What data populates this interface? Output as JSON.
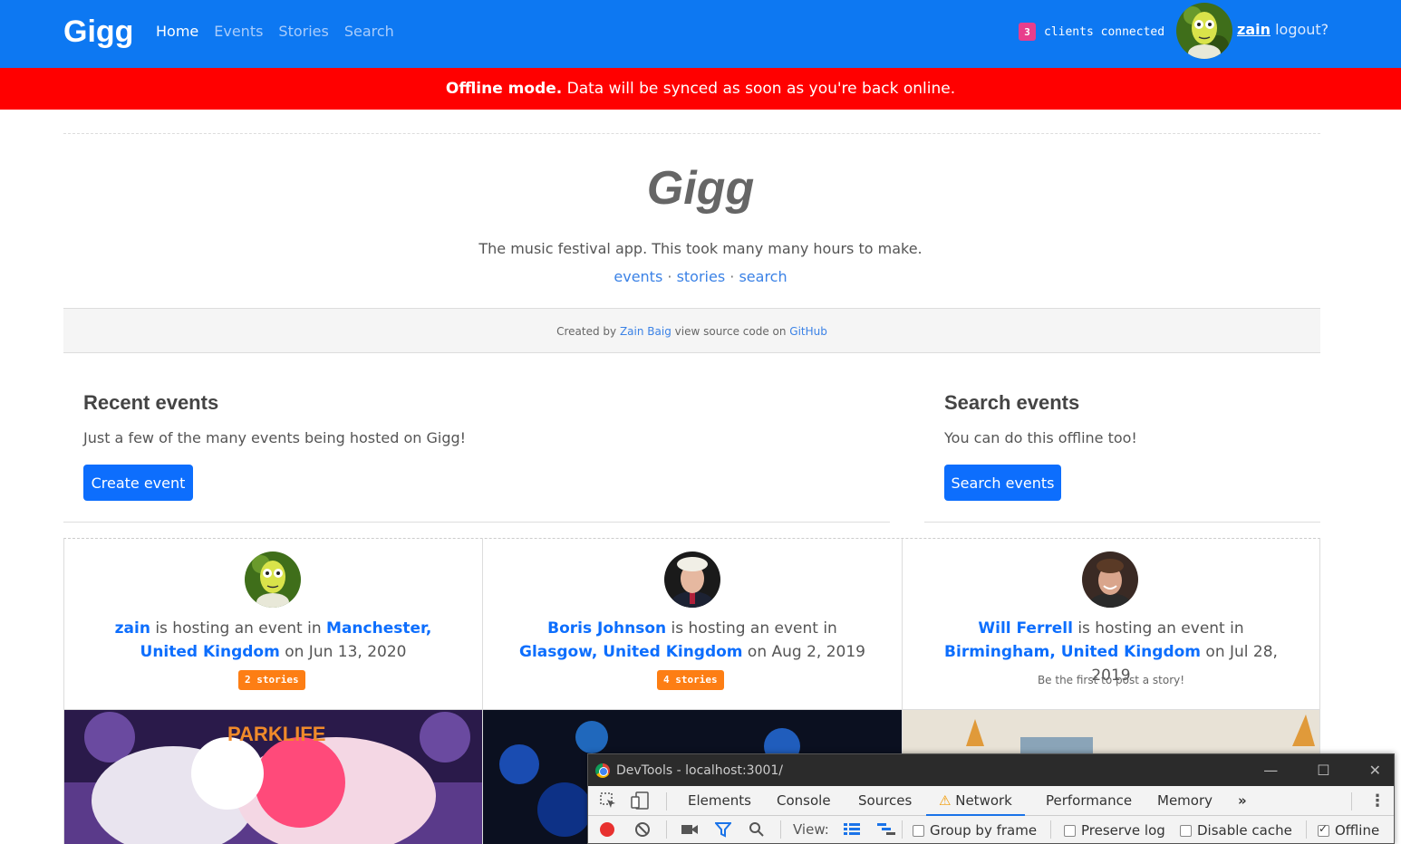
{
  "navbar": {
    "brand": "Gigg",
    "links": [
      "Home",
      "Events",
      "Stories",
      "Search"
    ],
    "clients_count": "3",
    "clients_label": "clients connected",
    "username": "zain",
    "logout": "logout?"
  },
  "offline_banner": {
    "bold": "Offline mode.",
    "text": " Data will be synced as soon as you're back online."
  },
  "hero": {
    "title": "Gigg",
    "subtitle": "The music festival app. This took many many hours to make.",
    "links": [
      "events",
      "stories",
      "search"
    ],
    "separator": "·",
    "credit_prefix": "Created by",
    "credit_author": "Zain Baig",
    "credit_middle": "view source code on",
    "credit_link": "GitHub"
  },
  "recent_events": {
    "heading": "Recent events",
    "description": "Just a few of the many events being hosted on Gigg!",
    "button": "Create event"
  },
  "search_events": {
    "heading": "Search events",
    "description": "You can do this offline too!",
    "button": "Search events"
  },
  "cards": [
    {
      "host": "zain",
      "hosting_text": " is hosting an event in ",
      "location": "Manchester, United Kingdom",
      "date_text": " on Jun 13, 2020",
      "stories": "2 stories"
    },
    {
      "host": "Boris Johnson",
      "hosting_text": " is hosting an event in ",
      "location": "Glasgow, United Kingdom",
      "date_text": " on Aug 2, 2019",
      "stories": "4 stories"
    },
    {
      "host": "Will Ferrell",
      "hosting_text": " is hosting an event in ",
      "location": "Birmingham, United Kingdom",
      "date_text": " on Jul 28, 2019",
      "no_stories": "Be the first to post a story!"
    }
  ],
  "card_image_text": "PARKLIFE",
  "devtools": {
    "title": "DevTools - localhost:3001/",
    "tabs": [
      "Elements",
      "Console",
      "Sources",
      "Network",
      "Performance",
      "Memory"
    ],
    "active_tab": "Network",
    "more": "»",
    "view_label": "View:",
    "group_by_frame": "Group by frame",
    "preserve_log": "Preserve log",
    "disable_cache": "Disable cache",
    "offline": "Offline"
  },
  "colors": {
    "navbar": "#0d78f2",
    "offline_banner": "#ff0000",
    "primary": "#0d6efd",
    "badge_pink": "#e83e8c",
    "badge_orange": "#fd7e14"
  }
}
